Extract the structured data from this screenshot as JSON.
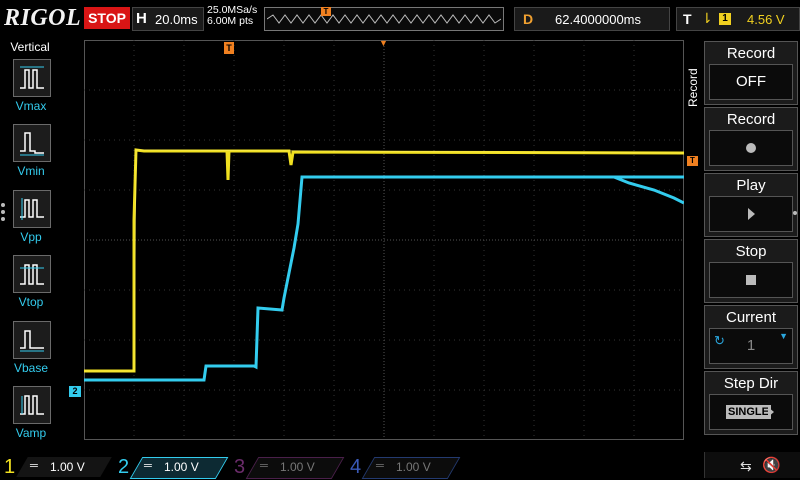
{
  "topbar": {
    "logo": "RIGOL",
    "run_state": "STOP",
    "horizontal_label": "H",
    "horizontal_scale": "20.0ms",
    "sample_rate": "25.0MSa/s",
    "memory_depth": "6.00M pts",
    "trigger_marker": "T",
    "delay_label": "D",
    "delay_value": "62.4000000ms",
    "trigger_label": "T",
    "trigger_edge": "⇂",
    "trigger_source": "1",
    "trigger_level": "4.56 V"
  },
  "left_panel": {
    "title": "Vertical",
    "items": [
      {
        "label": "Vmax",
        "icon": "vmax-icon"
      },
      {
        "label": "Vmin",
        "icon": "vmin-icon"
      },
      {
        "label": "Vpp",
        "icon": "vpp-icon"
      },
      {
        "label": "Vtop",
        "icon": "vtop-icon"
      },
      {
        "label": "Vbase",
        "icon": "vbase-icon"
      },
      {
        "label": "Vamp",
        "icon": "vamp-icon"
      }
    ]
  },
  "right_panel": {
    "vertical_title": "Record",
    "groups": [
      {
        "title": "Record",
        "value": "OFF"
      },
      {
        "title": "Record",
        "value": "",
        "icon": "record-dot-icon"
      },
      {
        "title": "Play",
        "value": "",
        "icon": "play-icon"
      },
      {
        "title": "Stop",
        "value": "",
        "icon": "stop-square-icon"
      },
      {
        "title": "Current",
        "value": "1"
      },
      {
        "title": "Step Dir",
        "value": "SINGLE"
      }
    ]
  },
  "markers": {
    "trigger_top": "T",
    "trigger_level_right": "T",
    "ch2_position": "2"
  },
  "channels": [
    {
      "num": "1",
      "coupling": "═",
      "scale": "1.00 V",
      "color": "#f0e020",
      "active": true
    },
    {
      "num": "2",
      "coupling": "═",
      "scale": "1.00 V",
      "color": "#33ccee",
      "active": true
    },
    {
      "num": "3",
      "coupling": "═",
      "scale": "1.00 V",
      "color": "#c040c0",
      "active": false
    },
    {
      "num": "4",
      "coupling": "═",
      "scale": "1.00 V",
      "color": "#3a5ab8",
      "active": false
    }
  ],
  "colors": {
    "ch1": "#f0e020",
    "ch2": "#33ccee",
    "trigger": "#f08020",
    "grid": "#3a3a3a",
    "brand_red": "#d91515"
  },
  "status_icons": [
    "usb-icon",
    "speaker-muted-icon"
  ]
}
